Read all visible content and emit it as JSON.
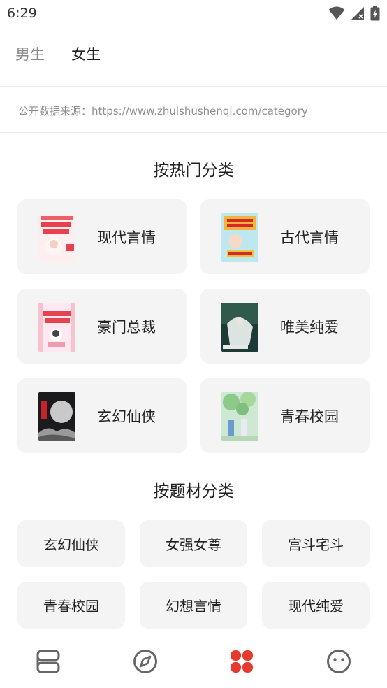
{
  "status_bar": {
    "time": "6:29",
    "icons": [
      "wifi-icon",
      "signal-icon",
      "battery-icon"
    ]
  },
  "gender_tabs": [
    {
      "label": "男生",
      "active": false
    },
    {
      "label": "女生",
      "active": true
    }
  ],
  "source_note": "公开数据来源：https://www.zhuishushenqi.com/category",
  "hot_section": {
    "title": "按热门分类",
    "items": [
      {
        "label": "现代言情",
        "cover": "book-cover-modern-romance"
      },
      {
        "label": "古代言情",
        "cover": "book-cover-ancient-romance"
      },
      {
        "label": "豪门总裁",
        "cover": "book-cover-ceo"
      },
      {
        "label": "唯美纯爱",
        "cover": "book-cover-pure-love"
      },
      {
        "label": "玄幻仙侠",
        "cover": "book-cover-fantasy"
      },
      {
        "label": "青春校园",
        "cover": "book-cover-campus"
      }
    ]
  },
  "theme_section": {
    "title": "按题材分类",
    "items": [
      {
        "label": "玄幻仙侠"
      },
      {
        "label": "女强女尊"
      },
      {
        "label": "宫斗宅斗"
      },
      {
        "label": "青春校园"
      },
      {
        "label": "幻想言情"
      },
      {
        "label": "现代纯爱"
      }
    ]
  },
  "bottom_nav": {
    "items": [
      {
        "icon": "bookshelf-icon",
        "active": false
      },
      {
        "icon": "compass-icon",
        "active": false
      },
      {
        "icon": "category-icon",
        "active": true
      },
      {
        "icon": "profile-icon",
        "active": false
      }
    ]
  },
  "colors": {
    "accent": "#e53b2f",
    "card_bg": "#f4f4f4",
    "muted_text": "#8f8f8f",
    "icon_gray": "#666666"
  }
}
